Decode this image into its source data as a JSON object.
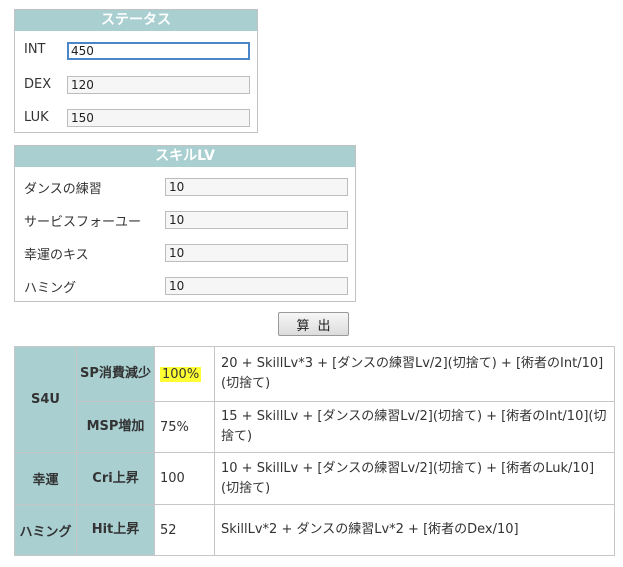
{
  "status": {
    "title": "ステータス",
    "fields": [
      {
        "label": "INT",
        "value": "450"
      },
      {
        "label": "DEX",
        "value": "120"
      },
      {
        "label": "LUK",
        "value": "150"
      }
    ]
  },
  "skill": {
    "title": "スキルLV",
    "fields": [
      {
        "label": "ダンスの練習",
        "value": "10"
      },
      {
        "label": "サービスフォーユー",
        "value": "10"
      },
      {
        "label": "幸運のキス",
        "value": "10"
      },
      {
        "label": "ハミング",
        "value": "10"
      }
    ]
  },
  "calc_button": "算出",
  "results": {
    "rows": [
      {
        "group": "S4U",
        "effect": "SP消費減少",
        "value": "100%",
        "formula": "20 + SkillLv*3 + [ダンスの練習Lv/2](切捨て) + [術者のInt/10](切捨て)"
      },
      {
        "group": "S4U",
        "effect": "MSP増加",
        "value": "75%",
        "formula": "15 + SkillLv + [ダンスの練習Lv/2](切捨て) + [術者のInt/10](切捨て)"
      },
      {
        "group": "幸運",
        "effect": "Cri上昇",
        "value": "100",
        "formula": "10 + SkillLv + [ダンスの練習Lv/2](切捨て) + [術者のLuk/10](切捨て)"
      },
      {
        "group": "ハミング",
        "effect": "Hit上昇",
        "value": "52",
        "formula": "SkillLv*2 + ダンスの練習Lv*2 + [術者のDex/10]"
      }
    ]
  },
  "colors": {
    "header_bg": "#a9cfd1",
    "highlight": "#ffff33",
    "focus_border": "#4a86c8"
  }
}
